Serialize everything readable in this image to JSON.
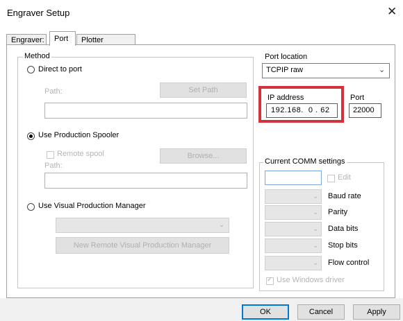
{
  "window": {
    "title": "Engraver Setup",
    "close_glyph": "✕"
  },
  "tabs": [
    {
      "label": "Engraver:"
    },
    {
      "label": "Port"
    },
    {
      "label": "Plotter Options"
    }
  ],
  "method": {
    "title": "Method",
    "direct": {
      "label": "Direct to port",
      "path_label": "Path:",
      "set_path_label": "Set Path",
      "path_value": ""
    },
    "spooler": {
      "label": "Use Production Spooler",
      "remote_spool_label": "Remote spool",
      "browse_label": "Browse...",
      "path_label": "Path:",
      "path_value": ""
    },
    "vpm": {
      "label": "Use Visual Production Manager",
      "select_value": "",
      "new_remote_label": "New Remote Visual Production Manager"
    }
  },
  "port_location": {
    "title": "Port location",
    "value": "TCPIP raw",
    "ip_label": "IP address",
    "ip_value": "192.168.  0 . 62",
    "port_label": "Port",
    "port_value": "22000",
    "highlight_color": "#d1323b"
  },
  "comm": {
    "title": "Current COMM settings",
    "edit_label": "Edit",
    "rows": [
      {
        "label": "Baud rate"
      },
      {
        "label": "Parity"
      },
      {
        "label": "Data bits"
      },
      {
        "label": "Stop bits"
      },
      {
        "label": "Flow control"
      }
    ],
    "windows_driver_label": "Use Windows driver"
  },
  "buttons": {
    "ok": "OK",
    "cancel": "Cancel",
    "apply": "Apply"
  },
  "colors": {
    "focus": "#0078d7",
    "comm_input_border": "#7aa7d3"
  }
}
